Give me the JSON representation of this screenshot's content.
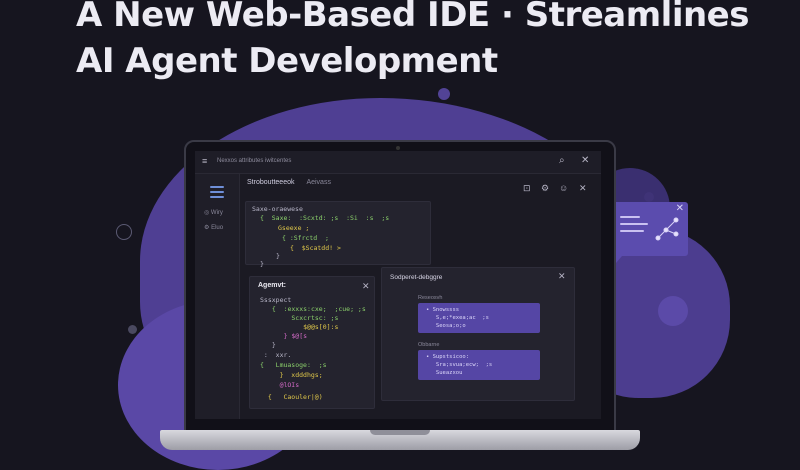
{
  "headline": {
    "line1": "A New Web-Based IDE · Streamlines",
    "line2": "AI Agent Development"
  },
  "colors": {
    "background": "#16151f",
    "accent": "#5546a5",
    "blob": "#4f3f93",
    "code_green": "#8bd06b",
    "code_yellow": "#e0c84a",
    "code_pink": "#d36bc7"
  },
  "window": {
    "menu_icon": "menu-icon",
    "title": "Nexxos attributes iwitcentes",
    "search_icon": "search-icon",
    "close_icon": "close-icon"
  },
  "sidebar": {
    "items": [
      {
        "icon": "globe-icon",
        "label": "Wiry"
      },
      {
        "icon": "gear-icon",
        "label": "Eluo"
      }
    ]
  },
  "toolbar": {
    "title": "Stroboutteeeok",
    "subtitle": "Aeivass",
    "icons": [
      "save-icon",
      "settings-icon",
      "emoji-icon",
      "close-icon"
    ]
  },
  "editor": {
    "lines": [
      {
        "indent": "",
        "text": "Saxe-oraewese"
      },
      {
        "indent": "  ",
        "text": "{  Saxe:  :Scxtd: ;s  :Si  :s  ;s"
      },
      {
        "indent": "      ",
        "text": "Gseexe ;"
      },
      {
        "indent": "      ",
        "text": "{ :Sfrctd  ;"
      },
      {
        "indent": "        ",
        "text": "{  $Scatdd! >"
      },
      {
        "indent": "  ",
        "text": "}"
      },
      {
        "indent": "  ",
        "text": "}"
      }
    ]
  },
  "agent_panel": {
    "title": "Agemvt:",
    "lines": [
      {
        "text": "Sssxpect"
      },
      {
        "text": "  {  :exxxs:cxe;  ;cue; ;s"
      },
      {
        "text": "       Scxcrtsc: ;s"
      },
      {
        "text": "          $@@s[0]:s"
      },
      {
        "text": "     } $@[s"
      },
      {
        "text": "  }"
      },
      {
        "text": " :  xxr."
      },
      {
        "text": "{   Lmuasoge:  ;s"
      },
      {
        "text": "     }  xdddhgs;"
      },
      {
        "text": "     @lOIs"
      },
      {
        "text": "  {   Caouler|@)"
      }
    ]
  },
  "debug_panel": {
    "title": "Sodperet-debggre",
    "sections": [
      {
        "label": "Reseosvh",
        "lines": [
          "• Snowssss",
          "   S,e;*exea;ac  ;s",
          "   Seosa;o;o"
        ]
      },
      {
        "label": "Obbarne",
        "lines": [
          "• Supstsicoo:",
          "   Sra;svua;ecw;  ;s",
          "   Sueazxou"
        ]
      }
    ]
  }
}
